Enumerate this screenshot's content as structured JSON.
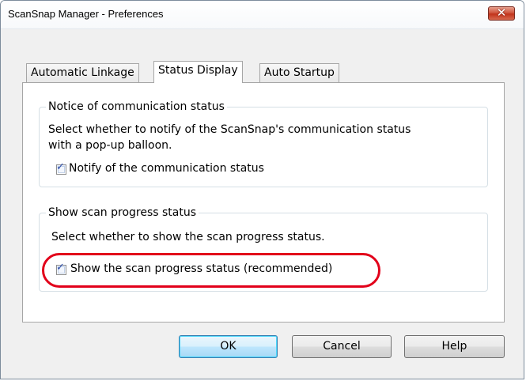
{
  "window": {
    "title": "ScanSnap Manager - Preferences",
    "close_glyph": "✕"
  },
  "tabs": [
    {
      "label": "Automatic Linkage",
      "active": false
    },
    {
      "label": "Status Display",
      "active": true
    },
    {
      "label": "Auto Startup",
      "active": false
    }
  ],
  "groups": {
    "communication": {
      "legend": "Notice of communication status",
      "description_line1": "Select whether to notify of the ScanSnap's communication status",
      "description_line2": "with a pop-up balloon.",
      "checkbox_label": "Notify of the communication status",
      "checked": true
    },
    "progress": {
      "legend": "Show scan progress status",
      "description": "Select whether to show the scan progress status.",
      "checkbox_label": "Show the scan progress status (recommended)",
      "checked": true
    }
  },
  "buttons": {
    "ok": "OK",
    "cancel": "Cancel",
    "help": "Help"
  },
  "colors": {
    "highlight_ring": "#e2001a",
    "close_button": "#c2331b",
    "default_button_border": "#3c7fb1"
  },
  "icons": {
    "check": "✓"
  }
}
